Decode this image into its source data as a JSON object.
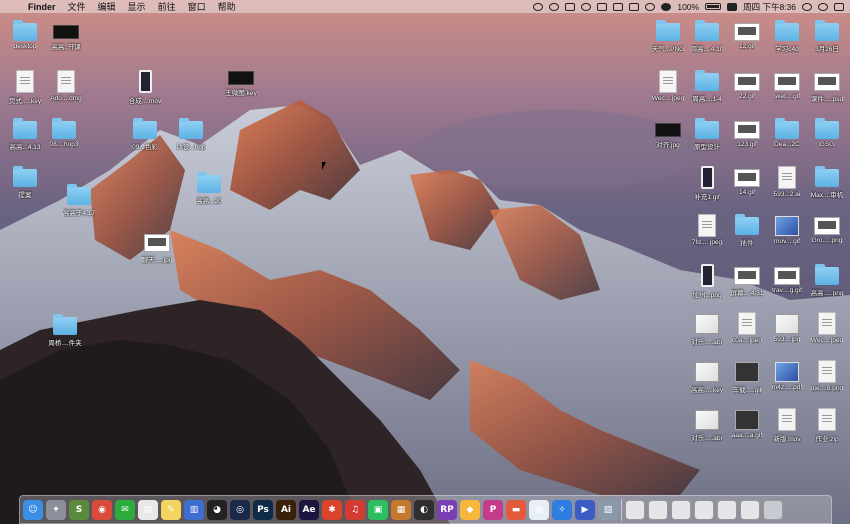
{
  "menubar": {
    "app_name": "Finder",
    "items": [
      "文件",
      "编辑",
      "显示",
      "前往",
      "窗口",
      "帮助"
    ],
    "battery": "100%",
    "clock": "周四 下午8:36"
  },
  "desktop_icons": [
    {
      "label": "desktop",
      "type": "folder"
    },
    {
      "label": "高高..开课",
      "type": "dark"
    },
    {
      "label": "页式.....key",
      "type": "doc"
    },
    {
      "label": "Ado....dmg",
      "type": "doc"
    },
    {
      "label": "合成....mov",
      "type": "phone"
    },
    {
      "label": "王微图.key",
      "type": "dark"
    },
    {
      "label": "高高...4.13",
      "type": "folder"
    },
    {
      "label": "08....hop3",
      "type": "folder"
    },
    {
      "label": "09...色彩",
      "type": "folder"
    },
    {
      "label": "UI设...hop",
      "type": "folder"
    },
    {
      "label": "提案",
      "type": "folder"
    },
    {
      "label": "高高于4.17",
      "type": "folder"
    },
    {
      "label": "高高...20",
      "type": "folder"
    },
    {
      "label": "聊天.....jpg",
      "type": "shot"
    },
    {
      "label": "周桥....件夹",
      "type": "folder"
    },
    {
      "label": "天气...PNG",
      "type": "folder"
    },
    {
      "label": "周高....4.10",
      "type": "folder"
    },
    {
      "label": "12.gif",
      "type": "shot"
    },
    {
      "label": "学习c4d",
      "type": "folder"
    },
    {
      "label": "3月26日",
      "type": "folder"
    },
    {
      "label": "Wec....jpeg",
      "type": "doc"
    },
    {
      "label": "周高....1-4",
      "type": "folder"
    },
    {
      "label": "22.gif",
      "type": "shot"
    },
    {
      "label": "sket....gif",
      "type": "shot"
    },
    {
      "label": "课件.....psd",
      "type": "shot"
    },
    {
      "label": "对齐.jpg",
      "type": "dark"
    },
    {
      "label": "原型设计",
      "type": "folder"
    },
    {
      "label": "123.gif",
      "type": "shot"
    },
    {
      "label": "Dea...2C",
      "type": "folder"
    },
    {
      "label": "GSG",
      "type": "folder"
    },
    {
      "label": "补充1.gif",
      "type": "phone"
    },
    {
      "label": "14.gif",
      "type": "shot"
    },
    {
      "label": "593...2.ai",
      "type": "doc"
    },
    {
      "label": "Max....审机",
      "type": "folder"
    },
    {
      "label": "7fd.....jpeg",
      "type": "doc"
    },
    {
      "label": "插件",
      "type": "folder"
    },
    {
      "label": "mov....gif",
      "type": "bluepic"
    },
    {
      "label": "Gro.....png",
      "type": "shot"
    },
    {
      "label": "加州...png",
      "type": "phone"
    },
    {
      "label": "屏幕....4.31",
      "type": "shot"
    },
    {
      "label": "trav....g.gif",
      "type": "shot"
    },
    {
      "label": "高高.....png",
      "type": "folder"
    },
    {
      "label": "对乐.....abr",
      "type": "gif"
    },
    {
      "label": "c0a....jpeg",
      "type": "doc"
    },
    {
      "label": "593....jpg",
      "type": "gif"
    },
    {
      "label": "Wec....jpeg",
      "type": "doc"
    },
    {
      "label": "高高.....key",
      "type": "gif"
    },
    {
      "label": "车载.....gif",
      "type": "movie"
    },
    {
      "label": "m4z.....pdf",
      "type": "bluepic"
    },
    {
      "label": "die....8.png",
      "type": "doc"
    },
    {
      "label": "对乐.....abr",
      "type": "gif"
    },
    {
      "label": "aaa....a.gif",
      "type": "movie"
    },
    {
      "label": "新版.mov",
      "type": "doc"
    },
    {
      "label": "作业.zip",
      "type": "doc"
    }
  ],
  "dock": {
    "apps": [
      {
        "name": "finder-icon",
        "glyph": "☺",
        "color": "#3a8ee6"
      },
      {
        "name": "launchpad-icon",
        "glyph": "✦",
        "color": "#8a8f99"
      },
      {
        "name": "scrivener-icon",
        "glyph": "S",
        "color": "#5a8a3c"
      },
      {
        "name": "chrome-icon",
        "glyph": "◉",
        "color": "#d84b3a"
      },
      {
        "name": "wechat-icon",
        "glyph": "✉",
        "color": "#2bad3d"
      },
      {
        "name": "preview-icon",
        "glyph": "▤",
        "color": "#e8e8e8"
      },
      {
        "name": "notes-icon",
        "glyph": "✎",
        "color": "#f4d35e"
      },
      {
        "name": "keynote-icon",
        "glyph": "▥",
        "color": "#3d6fd1"
      },
      {
        "name": "qq-icon",
        "glyph": "◕",
        "color": "#222"
      },
      {
        "name": "cinema4d-icon",
        "glyph": "◎",
        "color": "#1c2a4a"
      },
      {
        "name": "photoshop-icon",
        "glyph": "Ps",
        "color": "#0e2a47"
      },
      {
        "name": "illustrator-icon",
        "glyph": "Ai",
        "color": "#3a1f0a"
      },
      {
        "name": "after-effects-icon",
        "glyph": "Ae",
        "color": "#1d1440"
      },
      {
        "name": "xmind-icon",
        "glyph": "✱",
        "color": "#d9442a"
      },
      {
        "name": "netease-music-icon",
        "glyph": "♫",
        "color": "#d43c33"
      },
      {
        "name": "evernote-icon",
        "glyph": "▣",
        "color": "#2dbe60"
      },
      {
        "name": "photo-editor-icon",
        "glyph": "▦",
        "color": "#c47a2c"
      },
      {
        "name": "obs-icon",
        "glyph": "◐",
        "color": "#302e31"
      },
      {
        "name": "axure-icon",
        "glyph": "RP",
        "color": "#7b3fb5"
      },
      {
        "name": "sketch-icon",
        "glyph": "◆",
        "color": "#f6b73c"
      },
      {
        "name": "pockity-icon",
        "glyph": "P",
        "color": "#c43b8c"
      },
      {
        "name": "paste-icon",
        "glyph": "▬",
        "color": "#e25a3b"
      },
      {
        "name": "principle-icon",
        "glyph": "◍",
        "color": "#e8eef6"
      },
      {
        "name": "safari-icon",
        "glyph": "✧",
        "color": "#2f7de1"
      },
      {
        "name": "screenflow-icon",
        "glyph": "▶",
        "color": "#3b5cc4"
      },
      {
        "name": "photos-icon",
        "glyph": "▧",
        "color": "#8a9aaa"
      }
    ],
    "stacks": [
      "stack-1",
      "stack-2",
      "stack-3",
      "stack-4",
      "stack-5",
      "stack-6",
      "stack-7"
    ]
  }
}
